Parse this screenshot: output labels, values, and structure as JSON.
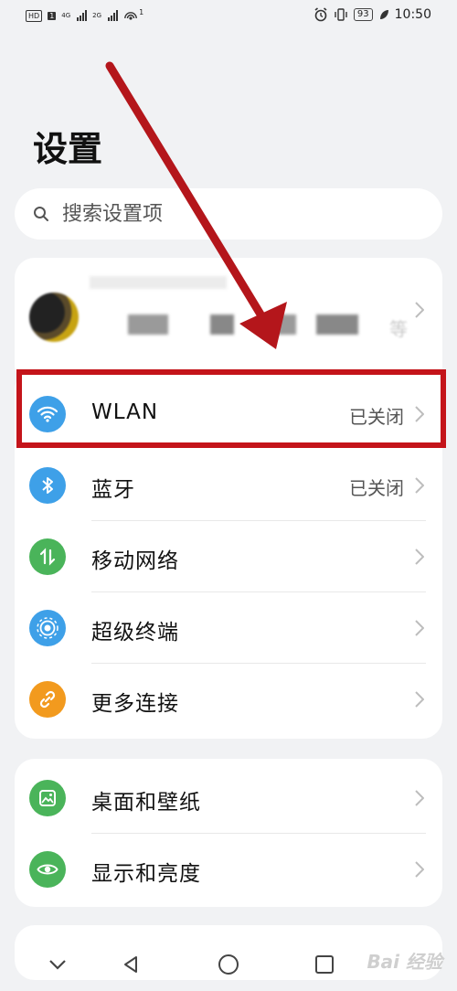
{
  "status_bar": {
    "left_badge": "HD",
    "sim1": "1",
    "net1": "4G",
    "net2": "2G",
    "wifi_badge": "1",
    "battery": "93",
    "time": "10:50"
  },
  "page": {
    "title": "设置"
  },
  "search": {
    "placeholder": "搜索设置项"
  },
  "account": {
    "suffix": "等"
  },
  "network_section": {
    "items": [
      {
        "label": "WLAN",
        "value": "已关闭",
        "icon": "wifi-icon",
        "color": "#3ea0e8"
      },
      {
        "label": "蓝牙",
        "value": "已关闭",
        "icon": "bluetooth-icon",
        "color": "#3ea0e8"
      },
      {
        "label": "移动网络",
        "value": "",
        "icon": "mobile-network-icon",
        "color": "#4ab45a"
      },
      {
        "label": "超级终端",
        "value": "",
        "icon": "super-device-icon",
        "color": "#3ea0e8"
      },
      {
        "label": "更多连接",
        "value": "",
        "icon": "link-icon",
        "color": "#f29a1e"
      }
    ]
  },
  "display_section": {
    "items": [
      {
        "label": "桌面和壁纸",
        "icon": "wallpaper-icon",
        "color": "#4ab45a"
      },
      {
        "label": "显示和亮度",
        "icon": "eye-icon",
        "color": "#4ab45a"
      }
    ]
  },
  "annotation": {
    "highlight_color": "#c4141a"
  },
  "watermark": "Bai 经验"
}
